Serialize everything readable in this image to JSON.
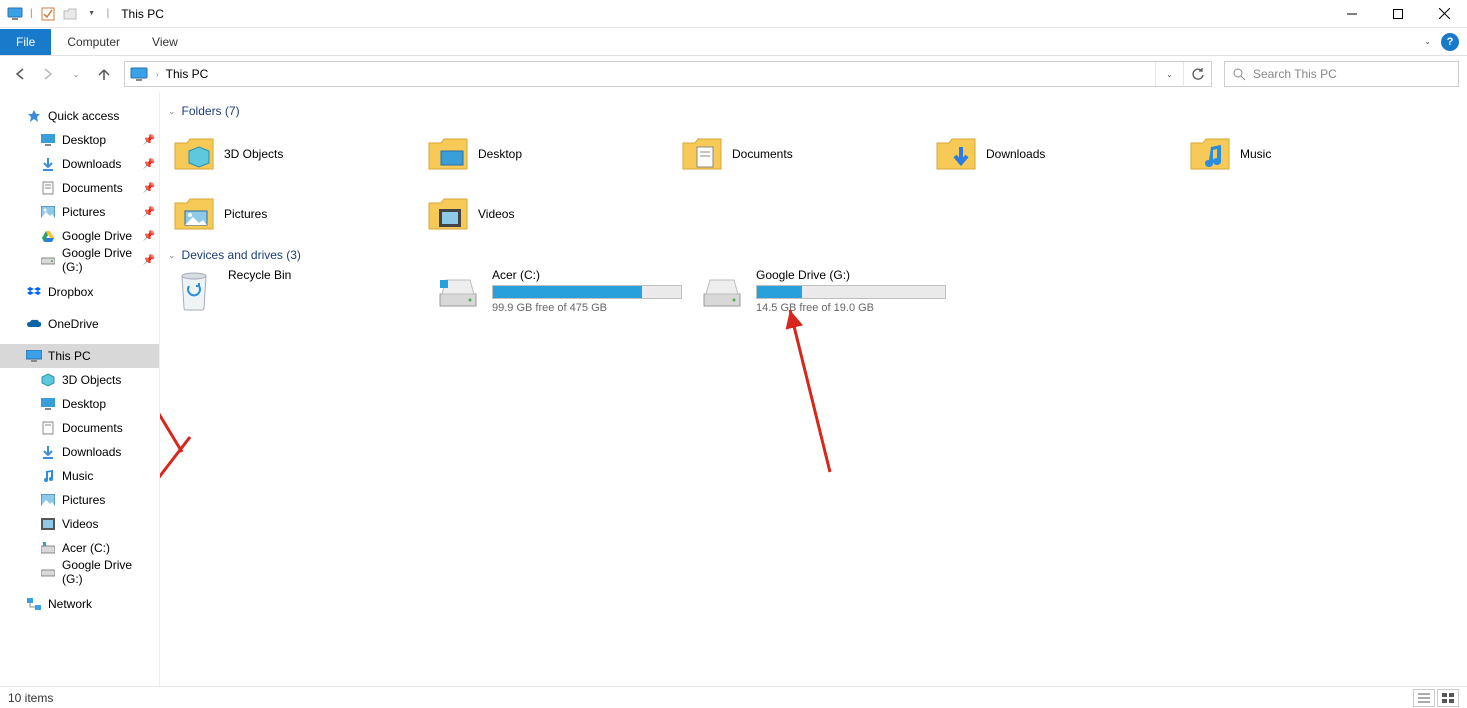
{
  "colors": {
    "accent": "#1979ca",
    "bar_fill": "#28a0da",
    "arrow": "#d8261c"
  },
  "title": "This PC",
  "ribbon": {
    "file": "File",
    "tabs": [
      "Computer",
      "View"
    ]
  },
  "nav": {
    "path": "This PC",
    "search_placeholder": "Search This PC"
  },
  "sidebar": {
    "quick_access": "Quick access",
    "qa_items": [
      {
        "label": "Desktop",
        "pinned": true
      },
      {
        "label": "Downloads",
        "pinned": true
      },
      {
        "label": "Documents",
        "pinned": true
      },
      {
        "label": "Pictures",
        "pinned": true
      },
      {
        "label": "Google Drive",
        "pinned": true
      },
      {
        "label": "Google Drive (G:)",
        "pinned": true
      }
    ],
    "dropbox": "Dropbox",
    "onedrive": "OneDrive",
    "this_pc": "This PC",
    "pc_items": [
      {
        "label": "3D Objects"
      },
      {
        "label": "Desktop"
      },
      {
        "label": "Documents"
      },
      {
        "label": "Downloads"
      },
      {
        "label": "Music"
      },
      {
        "label": "Pictures"
      },
      {
        "label": "Videos"
      },
      {
        "label": "Acer (C:)"
      },
      {
        "label": "Google Drive (G:)"
      }
    ],
    "network": "Network"
  },
  "content": {
    "folders_header": "Folders (7)",
    "folders": [
      {
        "label": "3D Objects",
        "kind": "3d"
      },
      {
        "label": "Desktop",
        "kind": "desktop"
      },
      {
        "label": "Documents",
        "kind": "documents"
      },
      {
        "label": "Downloads",
        "kind": "downloads"
      },
      {
        "label": "Music",
        "kind": "music"
      },
      {
        "label": "Pictures",
        "kind": "pictures"
      },
      {
        "label": "Videos",
        "kind": "videos"
      }
    ],
    "drives_header": "Devices and drives (3)",
    "drives": [
      {
        "label": "Recycle Bin",
        "kind": "recycle"
      },
      {
        "label": "Acer (C:)",
        "kind": "hdd",
        "free": "99.9 GB free of 475 GB",
        "fill_pct": 79
      },
      {
        "label": "Google Drive (G:)",
        "kind": "hdd",
        "free": "14.5 GB free of 19.0 GB",
        "fill_pct": 24
      }
    ]
  },
  "status": {
    "text": "10 items"
  }
}
